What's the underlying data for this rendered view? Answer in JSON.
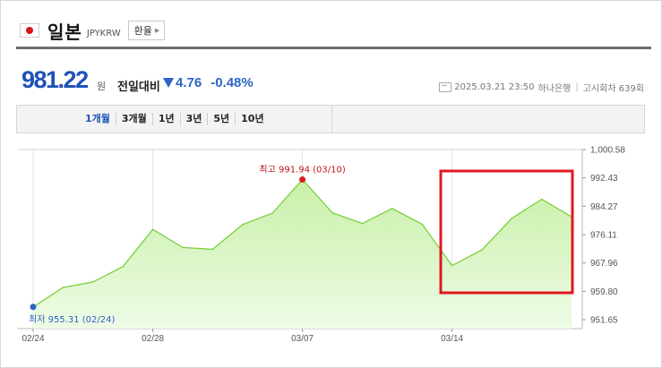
{
  "header": {
    "country": "일본",
    "code": "JPYKRW",
    "rate_button": "환율"
  },
  "quote": {
    "price": "981.22",
    "unit": "원",
    "prev_label": "전일대비",
    "change": "4.76",
    "change_pct": "-0.48%",
    "direction": "down",
    "timestamp": "2025.03.21 23:50",
    "bank": "하나은행",
    "notice": "고시회차 639회"
  },
  "tabs": [
    "1개월",
    "3개월",
    "1년",
    "3년",
    "5년",
    "10년"
  ],
  "chart_data": {
    "type": "area",
    "x": [
      "02/24",
      "02/25",
      "02/26",
      "02/27",
      "02/28",
      "03/03",
      "03/04",
      "03/05",
      "03/06",
      "03/07",
      "03/10",
      "03/11",
      "03/12",
      "03/13",
      "03/14",
      "03/17",
      "03/18",
      "03/19",
      "03/20",
      "03/21"
    ],
    "values": [
      955.31,
      960.9,
      962.5,
      966.9,
      977.6,
      972.4,
      971.9,
      979.0,
      982.3,
      991.94,
      982.4,
      979.3,
      983.6,
      979.1,
      967.2,
      971.7,
      980.8,
      986.3,
      981.22
    ],
    "ylim": [
      951.65,
      1000.58
    ],
    "yticks": [
      "1,000.58",
      "992.43",
      "984.27",
      "976.11",
      "967.96",
      "959.80",
      "951.65"
    ],
    "xticks": [
      "02/24",
      "02/28",
      "03/07",
      "03/14"
    ],
    "max_label": "최고 991.94 (03/10)",
    "min_label": "최저 955.31 (02/24)",
    "line_color": "#79d13f",
    "fill_color": "#c8f0a8",
    "highlight_color": "#e0191f"
  }
}
